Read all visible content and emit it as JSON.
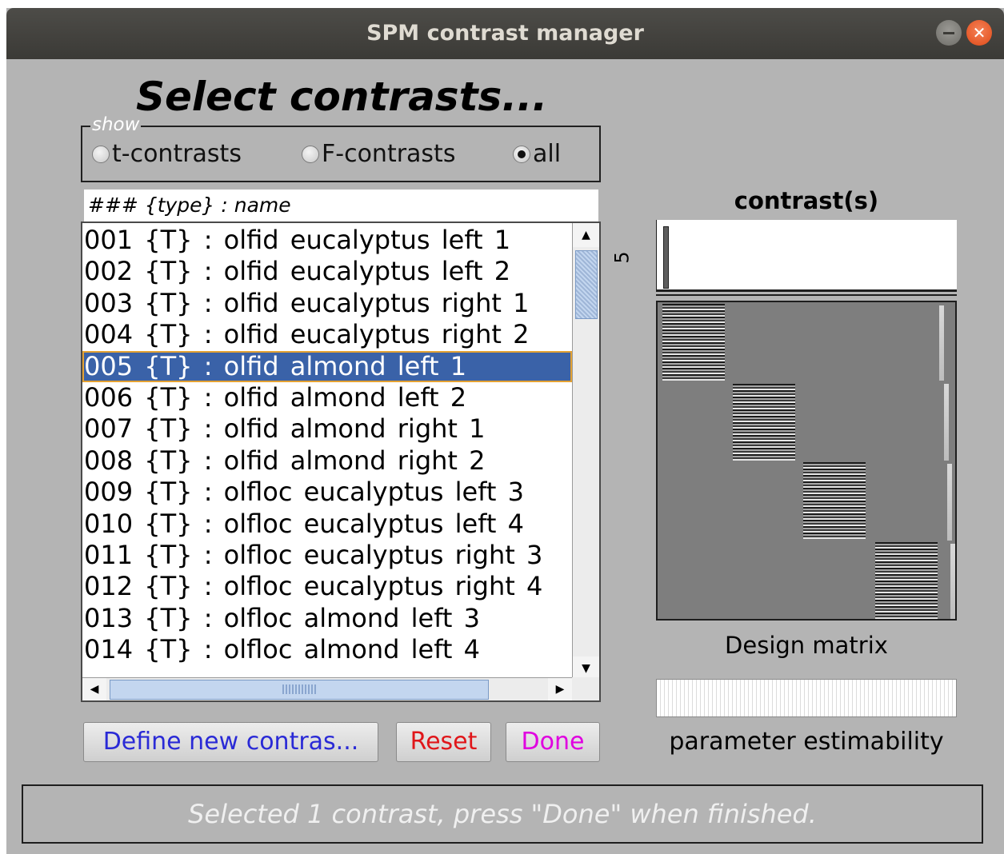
{
  "window": {
    "title": "SPM contrast manager"
  },
  "heading": "Select contrasts...",
  "show": {
    "legend": "show",
    "options": [
      {
        "label": "t-contrasts",
        "selected": false
      },
      {
        "label": "F-contrasts",
        "selected": false
      },
      {
        "label": "all",
        "selected": true
      }
    ]
  },
  "list": {
    "header": "### {type} : name",
    "items": [
      "001 {T} : olfid eucalyptus left 1",
      "002 {T} : olfid eucalyptus left 2",
      "003 {T} : olfid eucalyptus right 1",
      "004 {T} : olfid eucalyptus right 2",
      "005 {T} : olfid almond left 1",
      "006 {T} : olfid almond left 2",
      "007 {T} : olfid almond right 1",
      "008 {T} : olfid almond right 2",
      "009 {T} : olfloc eucalyptus left 3",
      "010 {T} : olfloc eucalyptus left 4",
      "011 {T} : olfloc eucalyptus right 3",
      "012 {T} : olfloc eucalyptus right 4",
      "013 {T} : olfloc almond left 3",
      "014 {T} : olfloc almond left 4"
    ],
    "selected_index": 4
  },
  "buttons": {
    "define": "Define new contras...",
    "reset": "Reset",
    "done": "Done"
  },
  "contrast": {
    "title": "contrast(s)",
    "axis_label": "5"
  },
  "design_matrix": {
    "caption": "Design matrix"
  },
  "estimability": {
    "caption": "parameter estimability"
  },
  "status": "Selected 1 contrast, press \"Done\" when finished.",
  "colors": {
    "background": "#b4b4b4",
    "selection": "#3a62a8",
    "define_text": "#2a2ad6",
    "reset_text": "#e0161a",
    "done_text": "#e000e0"
  }
}
